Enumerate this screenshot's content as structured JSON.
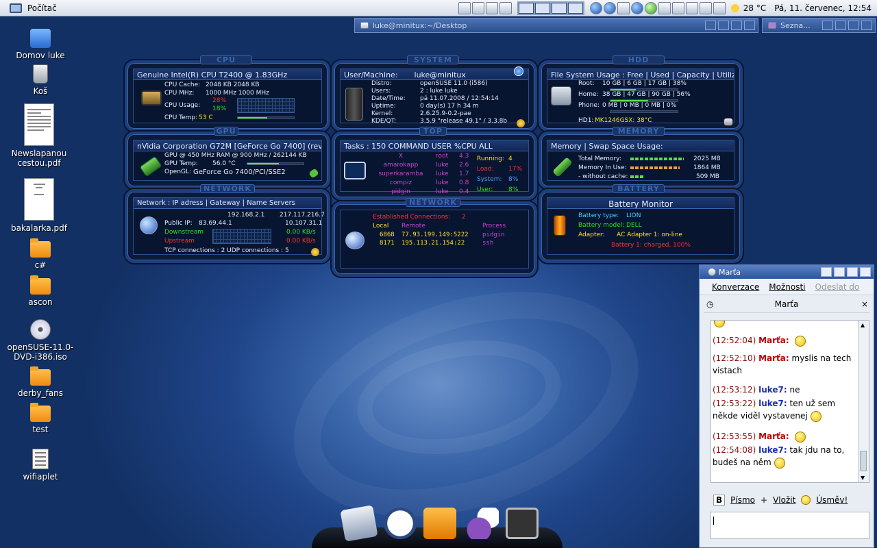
{
  "panel": {
    "start_label": "Počítač",
    "temperature": "28 °C",
    "clock": "Pá, 11. červenec, 12:54"
  },
  "taskbar": {
    "konsole_title": "luke@minitux:~/Desktop",
    "pidgin_title": "Sezna..."
  },
  "desktop_icons": [
    {
      "label": "Domov luke",
      "kind": "home"
    },
    {
      "label": "Koš",
      "kind": "trash"
    },
    {
      "label": "Newslapanou cestou.pdf",
      "kind": "pdf"
    },
    {
      "label": "bakalarka.pdf",
      "kind": "pdf"
    },
    {
      "label": "c#",
      "kind": "folder"
    },
    {
      "label": "ascon",
      "kind": "folder"
    },
    {
      "label": "openSUSE-11.0-DVD-i386.iso",
      "kind": "cd"
    },
    {
      "label": "derby_fans",
      "kind": "folder"
    },
    {
      "label": "test",
      "kind": "folder"
    },
    {
      "label": "wifiaplet",
      "kind": "text"
    }
  ],
  "cpu": {
    "tag": "CPU",
    "header": "Genuine Intel(R) CPU T2400 @ 1.83GHz",
    "cache_label": "CPU Cache:",
    "cache": "2048 KB 2048 KB",
    "mhz_label": "CPU MHz:",
    "mhz": "1000 MHz 1000 MHz",
    "usage_label": "CPU Usage:",
    "usage1": "28%",
    "usage2": "18%",
    "temp_label": "CPU Temp:",
    "temp": "53 C"
  },
  "system": {
    "tag": "SYSTEM",
    "header_label": "User/Machine:",
    "header_value": "luke@minitux",
    "distro_label": "Distro:",
    "distro": "openSUSE 11.0 (i586)",
    "users_label": "Users:",
    "users": "2  :  luke luke",
    "date_label": "Date/Time:",
    "date": "pá 11.07.2008  /  12:54:14",
    "uptime_label": "Uptime:",
    "uptime": "0 day(s) 17 h 34 m",
    "kernel_label": "Kernel:",
    "kernel": "2.6.25.9-0.2-pae",
    "kde_label": "KDE/QT:",
    "kde": "3.5.9 \"release 49.1\"  /    3.3.8b"
  },
  "hdd": {
    "tag": "HDD",
    "header": "File System Usage :   Free | Used | Capacity | Utilized",
    "root_label": "Root:",
    "root": "10 GB | 6 GB   | 17 GB | 38%",
    "root_util": 0.38,
    "home_label": "Home:",
    "home": "38 GB | 47 GB | 90 GB | 56%",
    "home_util": 0.56,
    "phone_label": "Phone:",
    "phone": "0 MB | 0 MB | 0 MB | 0%",
    "phone_util": 0,
    "disk_label": "HD1:",
    "disk": "MK1246GSX: 38°C"
  },
  "gpu": {
    "tag": "GPU",
    "header": "nVidia Corporation G72M [GeForce Go 7400] (rev a1)",
    "line1": "GPU @  450 MHz RAM @ 900 MHz / 262144  KB",
    "temp_label": "GPU Temp:",
    "temp": "56.0 °C",
    "opengl_label": "OpenGL:",
    "opengl": "GeForce Go 7400/PCI/SSE2"
  },
  "top": {
    "tag": "TOP",
    "header": "Tasks : 150   COMMAND  USER  %CPU    ALL",
    "processes": [
      {
        "cmd": "X",
        "user": "root",
        "cpu": "4.3"
      },
      {
        "cmd": "amarokapp",
        "user": "luke",
        "cpu": "2.6"
      },
      {
        "cmd": "superkaramba",
        "user": "luke",
        "cpu": "1.7"
      },
      {
        "cmd": "compiz",
        "user": "luke",
        "cpu": "0.8"
      },
      {
        "cmd": "pidgin",
        "user": "luke",
        "cpu": "0.4"
      }
    ],
    "running_label": "Running:",
    "running": "4",
    "load_label": "Load:",
    "load": "17%",
    "system_label": "System:",
    "system": "8%",
    "user_label": "User:",
    "user": "8%"
  },
  "memory": {
    "tag": "MEMORY",
    "header": "Memory | Swap Space Usage:",
    "total_label": "Total Memory:",
    "total": "2025 MB",
    "inuse_label": "Memory In Use:",
    "inuse": "1864 MB",
    "nocache_label": "- without cache:",
    "nocache": "509 MB"
  },
  "network": {
    "tag": "NETWORK",
    "header": "Network : IP adress      |      Gateway     |   Name Servers",
    "ip": "192.168.2.1",
    "ns": "217.117.216.7",
    "public_label": "Public IP:",
    "public": "83.69.44.1",
    "ns2": "10.107.31.1",
    "down_label": "Downstream",
    "down": "0.00 KB/s",
    "up_label": "Upstream",
    "up": "0.00 KB/s",
    "conns": "TCP connections :  2    UDP connections :  5"
  },
  "connections": {
    "tag": "NETWORK",
    "title": "Established Connections:",
    "count": "2",
    "col_local": "Local",
    "col_remote": "Remote",
    "col_process": "Process",
    "rows": [
      {
        "local": "6868",
        "remote": "77.93.199.149:5222",
        "process": "pidgin"
      },
      {
        "local": "8171",
        "remote": "195.113.21.154:22",
        "process": "ssh"
      }
    ]
  },
  "battery": {
    "tag": "BATTERY",
    "header": "Battery  Monitor",
    "type_label": "Battery type:",
    "type": "LION",
    "model_label": "Battery model:",
    "model": "DELL",
    "adapter_label": "Adapter:",
    "adapter": "AC Adapter 1: on-line",
    "status": "Battery 1: charged, 100%"
  },
  "chat": {
    "window_title": "Marťa",
    "menu": [
      "Konverzace",
      "Možnosti",
      "Odeslat do"
    ],
    "tab_title": "Marťa",
    "messages": [
      {
        "time": "(12:52:04)",
        "nick": "Marťa:",
        "text": ""
      },
      {
        "time": "(12:52:10)",
        "nick": "Marťa:",
        "text": "myslis na tech vistach"
      },
      {
        "time": "(12:53:12)",
        "nick": "luke7:",
        "text": "ne"
      },
      {
        "time": "(12:53:22)",
        "nick": "luke7:",
        "text": "ten už sem někde viděl vystavenej"
      },
      {
        "time": "(12:53:55)",
        "nick": "Marťa:",
        "text": ""
      },
      {
        "time": "(12:54:08)",
        "nick": "luke7:",
        "text": "tak jdu na to, budeš na něm"
      }
    ],
    "toolbar": {
      "font": "Písmo",
      "insert": "Vložit",
      "smile": "Úsměv!"
    }
  }
}
